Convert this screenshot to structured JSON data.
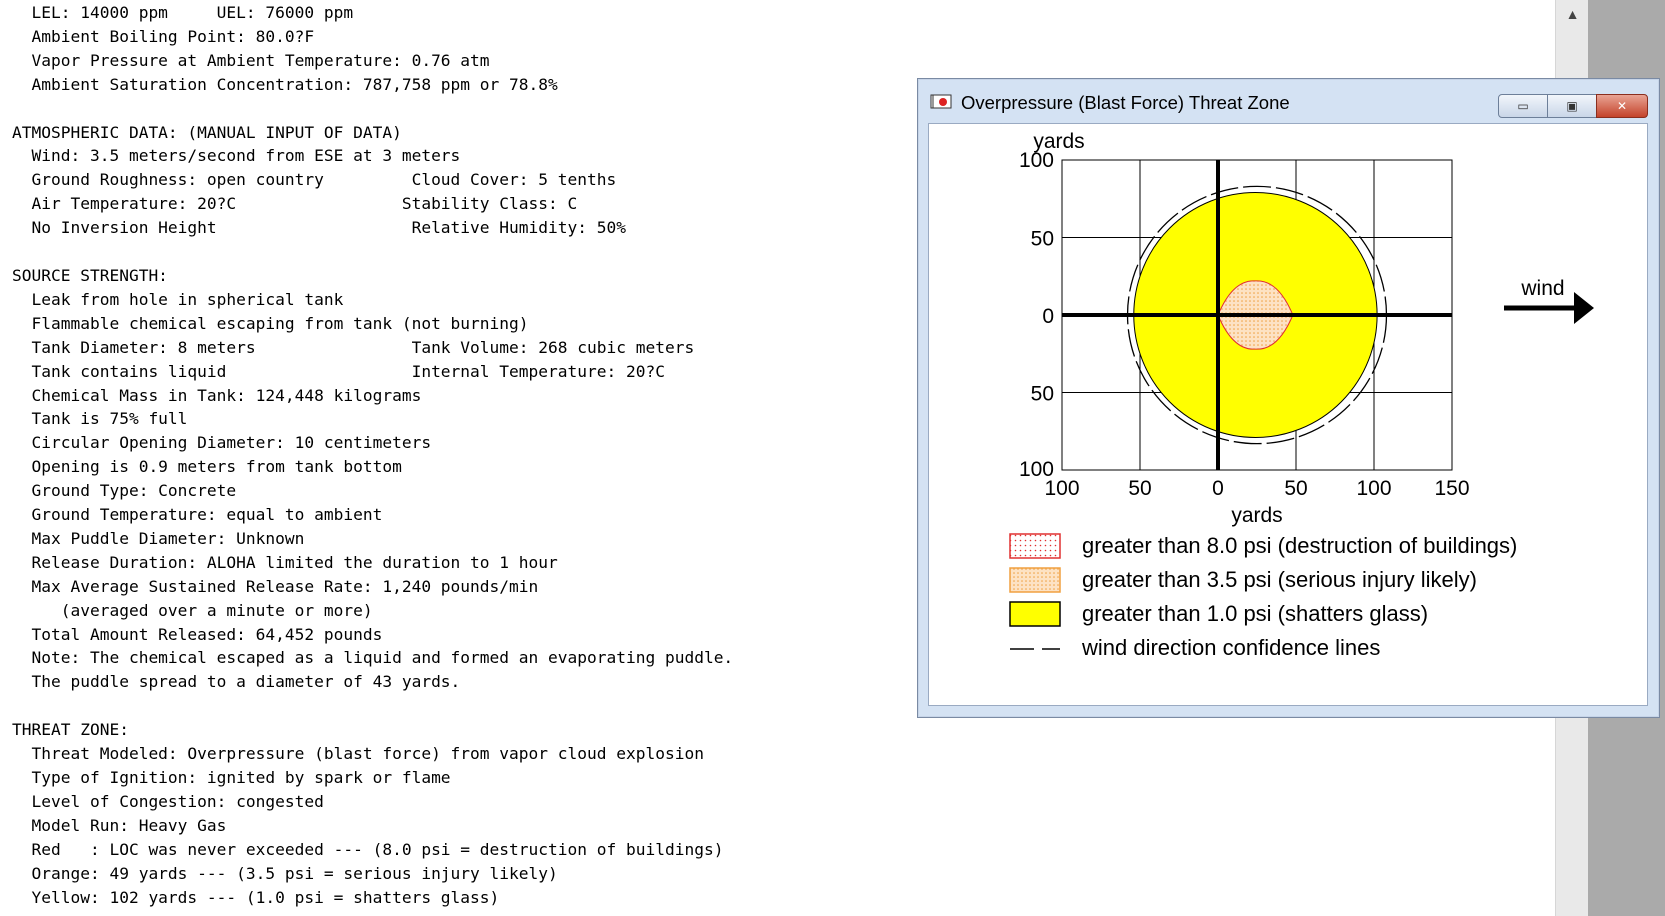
{
  "report": {
    "lines": [
      "  LEL: 14000 ppm     UEL: 76000 ppm",
      "  Ambient Boiling Point: 80.0?F",
      "  Vapor Pressure at Ambient Temperature: 0.76 atm",
      "  Ambient Saturation Concentration: 787,758 ppm or 78.8%",
      "",
      "ATMOSPHERIC DATA: (MANUAL INPUT OF DATA)",
      "  Wind: 3.5 meters/second from ESE at 3 meters",
      "  Ground Roughness: open country         Cloud Cover: 5 tenths",
      "  Air Temperature: 20?C                 Stability Class: C",
      "  No Inversion Height                    Relative Humidity: 50%",
      "",
      "SOURCE STRENGTH:",
      "  Leak from hole in spherical tank",
      "  Flammable chemical escaping from tank (not burning)",
      "  Tank Diameter: 8 meters                Tank Volume: 268 cubic meters",
      "  Tank contains liquid                   Internal Temperature: 20?C",
      "  Chemical Mass in Tank: 124,448 kilograms",
      "  Tank is 75% full",
      "  Circular Opening Diameter: 10 centimeters",
      "  Opening is 0.9 meters from tank bottom",
      "  Ground Type: Concrete",
      "  Ground Temperature: equal to ambient",
      "  Max Puddle Diameter: Unknown",
      "  Release Duration: ALOHA limited the duration to 1 hour",
      "  Max Average Sustained Release Rate: 1,240 pounds/min",
      "     (averaged over a minute or more)",
      "  Total Amount Released: 64,452 pounds",
      "  Note: The chemical escaped as a liquid and formed an evaporating puddle.",
      "  The puddle spread to a diameter of 43 yards.",
      "",
      "THREAT ZONE:",
      "  Threat Modeled: Overpressure (blast force) from vapor cloud explosion",
      "  Type of Ignition: ignited by spark or flame",
      "  Level of Congestion: congested",
      "  Model Run: Heavy Gas",
      "  Red   : LOC was never exceeded --- (8.0 psi = destruction of buildings)",
      "  Orange: 49 yards --- (3.5 psi = serious injury likely)",
      "  Yellow: 102 yards --- (1.0 psi = shatters glass)"
    ]
  },
  "window": {
    "title": "Overpressure (Blast Force) Threat Zone",
    "minimize_glyph": "▭",
    "maximize_glyph": "▣",
    "close_glyph": "✕"
  },
  "colors": {
    "red": "#e03030",
    "orange": "#f0a040",
    "orange_fill": "#fde0c0",
    "yellow": "#ffff00",
    "grid": "#000000"
  },
  "chart_data": {
    "type": "area",
    "xlabel": "yards",
    "ylabel": "yards",
    "xlim": [
      -100,
      150
    ],
    "ylim": [
      -100,
      100
    ],
    "x_ticks": [
      -100,
      -50,
      0,
      50,
      100,
      150
    ],
    "x_tick_labels": [
      "100",
      "50",
      "0",
      "50",
      "100",
      "150"
    ],
    "y_ticks": [
      100,
      50,
      0,
      -50,
      -100
    ],
    "y_tick_labels": [
      "100",
      "50",
      "0",
      "50",
      "100"
    ],
    "grid": true,
    "wind_label": "wind",
    "zones": [
      {
        "name": "greater than 8.0 psi (destruction of buildings)",
        "color": "#e03030",
        "fill": "none",
        "max_extent_yards": 0
      },
      {
        "name": "greater than 3.5 psi (serious injury likely)",
        "color": "#f0a040",
        "fill": "dotted",
        "center": [
          24,
          0
        ],
        "rx": 24,
        "ry": 22
      },
      {
        "name": "greater than 1.0 psi (shatters glass)",
        "color": "#ffff00",
        "fill": "solid",
        "center": [
          24,
          0
        ],
        "rx": 78,
        "ry": 79
      }
    ],
    "confidence_lines": {
      "label": "wind direction confidence lines",
      "center": [
        25,
        0
      ],
      "radius": 83
    },
    "legend": [
      {
        "label": "greater than 8.0 psi (destruction of buildings)",
        "swatch": "red-dotted"
      },
      {
        "label": "greater than 3.5 psi (serious injury likely)",
        "swatch": "orange-dotted"
      },
      {
        "label": "greater than 1.0 psi (shatters glass)",
        "swatch": "yellow-solid"
      },
      {
        "label": "wind direction confidence lines",
        "swatch": "dash"
      }
    ]
  }
}
